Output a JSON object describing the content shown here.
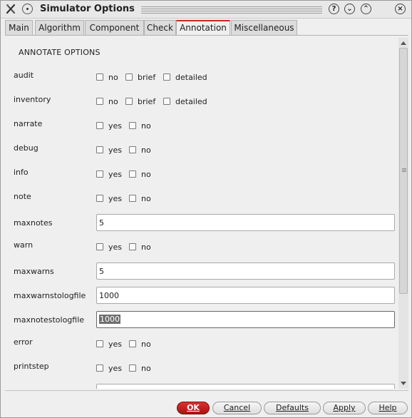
{
  "window": {
    "title": "Simulator Options",
    "title_buttons": [
      "?",
      "⌄",
      "⌃",
      "×"
    ]
  },
  "tabs": [
    {
      "label": "Main"
    },
    {
      "label": "Algorithm"
    },
    {
      "label": "Component"
    },
    {
      "label": "Check"
    },
    {
      "label": "Annotation",
      "active": true
    },
    {
      "label": "Miscellaneous"
    }
  ],
  "section_title": "ANNOTATE OPTIONS",
  "rows": {
    "audit": {
      "label": "audit",
      "options": [
        "no",
        "brief",
        "detailed"
      ]
    },
    "inventory": {
      "label": "inventory",
      "options": [
        "no",
        "brief",
        "detailed"
      ]
    },
    "narrate": {
      "label": "narrate",
      "options": [
        "yes",
        "no"
      ]
    },
    "debug": {
      "label": "debug",
      "options": [
        "yes",
        "no"
      ]
    },
    "info": {
      "label": "info",
      "options": [
        "yes",
        "no"
      ]
    },
    "note": {
      "label": "note",
      "options": [
        "yes",
        "no"
      ]
    },
    "maxnotes": {
      "label": "maxnotes",
      "value": "5"
    },
    "warn": {
      "label": "warn",
      "options": [
        "yes",
        "no"
      ]
    },
    "maxwarns": {
      "label": "maxwarns",
      "value": "5"
    },
    "maxwarnstologfile": {
      "label": "maxwarnstologfile",
      "value": "1000"
    },
    "maxnotestologfile": {
      "label": "maxnotestologfile",
      "value": "1000"
    },
    "error": {
      "label": "error",
      "options": [
        "yes",
        "no"
      ]
    },
    "printstep": {
      "label": "printstep",
      "options": [
        "yes",
        "no"
      ]
    }
  },
  "buttons": {
    "ok": "OK",
    "cancel": "Cancel",
    "defaults": "Defaults",
    "apply": "Apply",
    "help": "Help"
  },
  "colors": {
    "accent": "#c62828",
    "ok_button": "#c41a1a"
  }
}
